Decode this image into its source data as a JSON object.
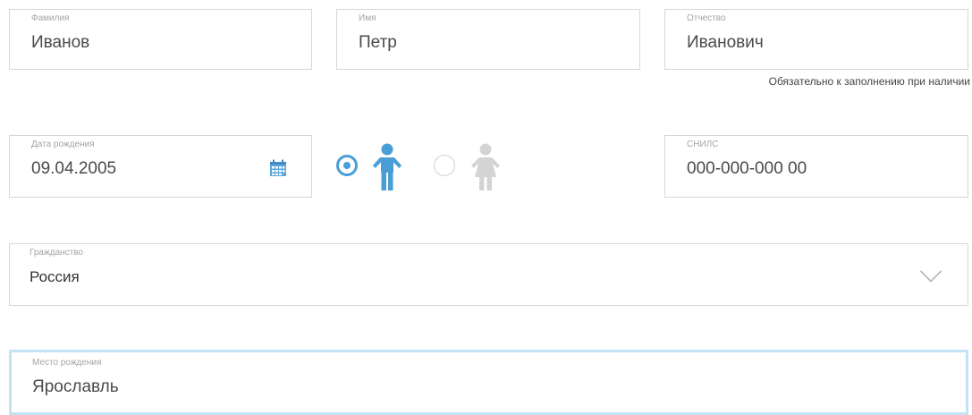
{
  "last_name": {
    "label": "Фамилия",
    "value": "Иванов"
  },
  "first_name": {
    "label": "Имя",
    "value": "Петр"
  },
  "middle_name": {
    "label": "Отчество",
    "value": "Иванович",
    "hint": "Обязательно к заполнению при наличии"
  },
  "birth_date": {
    "label": "Дата рождения",
    "value": "09.04.2005"
  },
  "gender": {
    "selected": "male"
  },
  "snils": {
    "label": "СНИЛС",
    "value": "000-000-000 00"
  },
  "citizenship": {
    "label": "Гражданство",
    "selected": "Россия"
  },
  "birth_place": {
    "label": "Место рождения",
    "value": "Ярославль"
  },
  "colors": {
    "accent": "#4a9ed6",
    "focus_border": "#c3e2f4",
    "inactive_icon": "#d4d4d4",
    "border": "#d6d6d6"
  }
}
